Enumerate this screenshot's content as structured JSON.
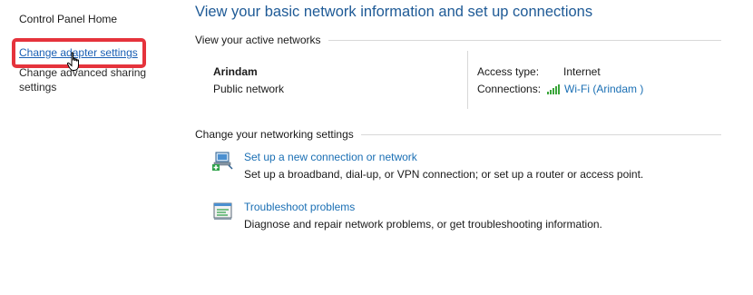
{
  "sidebar": {
    "home": "Control Panel Home",
    "adapter": "Change adapter settings",
    "sharing": "Change advanced sharing settings"
  },
  "main": {
    "title": "View your basic network information and set up connections",
    "active_header": "View your active networks",
    "network": {
      "name": "Arindam",
      "type": "Public network",
      "access_label": "Access type:",
      "access_value": "Internet",
      "connections_label": "Connections:",
      "connections_value": "Wi-Fi (Arindam )"
    },
    "settings_header": "Change your networking settings",
    "tasks": [
      {
        "link": "Set up a new connection or network",
        "desc": "Set up a broadband, dial-up, or VPN connection; or set up a router or access point.",
        "icon": "new-connection-icon"
      },
      {
        "link": "Troubleshoot problems",
        "desc": "Diagnose and repair network problems, or get troubleshooting information.",
        "icon": "troubleshoot-icon"
      }
    ]
  },
  "colors": {
    "title": "#1e5a96",
    "link": "#1a6fb4",
    "highlight": "#e5333c",
    "wifi": "#3aa63a"
  }
}
